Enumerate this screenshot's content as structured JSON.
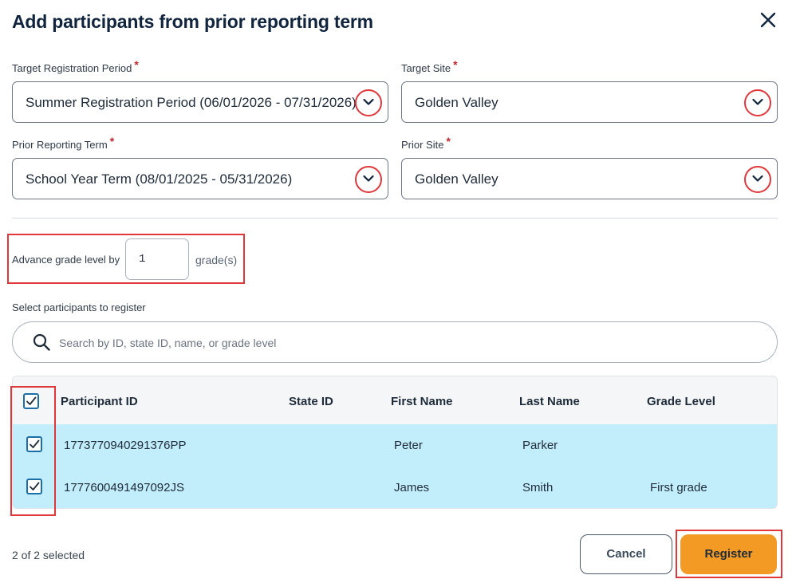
{
  "dialog": {
    "title": "Add participants from prior reporting term"
  },
  "fields": {
    "target_registration_period": {
      "label": "Target Registration Period",
      "required_mark": "*",
      "value": "Summer Registration Period (06/01/2026 - 07/31/2026)"
    },
    "target_site": {
      "label": "Target Site",
      "required_mark": "*",
      "value": "Golden Valley"
    },
    "prior_reporting_term": {
      "label": "Prior Reporting Term",
      "required_mark": "*",
      "value": "School Year Term (08/01/2025 - 05/31/2026)"
    },
    "prior_site": {
      "label": "Prior Site",
      "required_mark": "*",
      "value": "Golden Valley"
    }
  },
  "advance": {
    "label": "Advance grade level by",
    "value": "1",
    "suffix": "grade(s)"
  },
  "participants": {
    "section_label": "Select participants to register",
    "search_placeholder": "Search by ID, state ID, name, or grade level",
    "columns": [
      "Participant ID",
      "State ID",
      "First Name",
      "Last Name",
      "Grade Level"
    ],
    "rows": [
      {
        "participant_id": "1773770940291376PP",
        "state_id": "",
        "first_name": "Peter",
        "last_name": "Parker",
        "grade_level": "",
        "checked": true
      },
      {
        "participant_id": "1777600491497092JS",
        "state_id": "",
        "first_name": "James",
        "last_name": "Smith",
        "grade_level": "First grade",
        "checked": true
      }
    ],
    "select_all_checked": true
  },
  "footer": {
    "selected_count": "2 of 2 selected",
    "cancel_label": "Cancel",
    "register_label": "Register"
  },
  "colors": {
    "title": "#10243e",
    "selected_row": "#c2edfb",
    "register_button": "#f39a24",
    "highlight_outline": "#e0373a",
    "checkbox": "#1a6fa6"
  },
  "icons": {
    "close": "close-icon",
    "dropdown": "chevron-down-icon",
    "search": "search-icon",
    "checkbox": "checkmark-icon"
  }
}
